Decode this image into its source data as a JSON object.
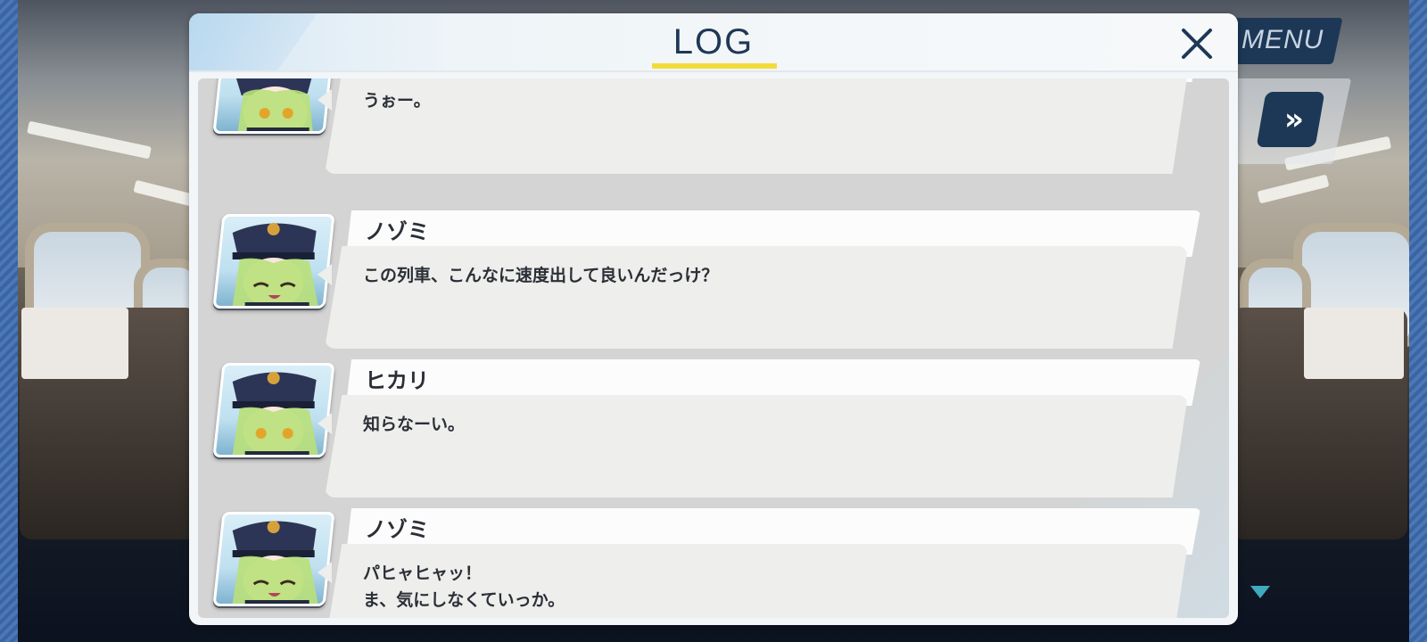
{
  "dialog": {
    "title": "LOG",
    "close_label": "✕"
  },
  "controls": {
    "menu_label": "MENU",
    "skip_label": "»"
  },
  "log": [
    {
      "speaker": "",
      "text": "うぉー。"
    },
    {
      "speaker": "ノゾミ",
      "text": "この列車、こんなに速度出して良いんだっけ？"
    },
    {
      "speaker": "ヒカリ",
      "text": "知らなーい。"
    },
    {
      "speaker": "ノゾミ",
      "text": "パヒャヒャッ！\nま、気にしなくていっか。"
    }
  ],
  "colors": {
    "accent_underline": "#f2dc3a",
    "navy": "#1e3856",
    "next_arrow": "#3fa9c0"
  },
  "icons": {
    "close": "close-icon",
    "skip": "fast-forward-icon",
    "next": "triangle-down-icon"
  }
}
